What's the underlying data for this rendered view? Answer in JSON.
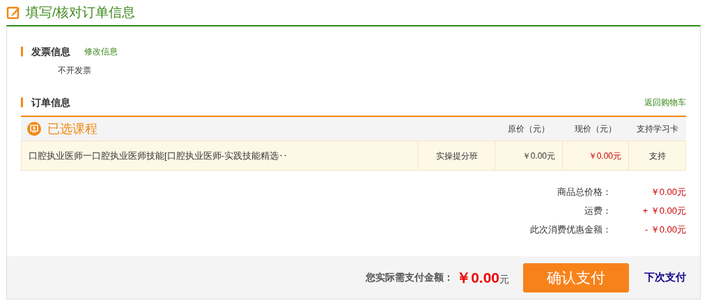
{
  "page_title": "填写/核对订单信息",
  "invoice": {
    "heading": "发票信息",
    "edit_link": "修改信息",
    "value": "不开发票"
  },
  "order": {
    "heading": "订单信息",
    "back_link": "返回购物车",
    "table": {
      "title": "已选课程",
      "columns": [
        "原价（元）",
        "现价（元）",
        "支持学习卡"
      ],
      "rows": [
        {
          "name": "口腔执业医师一口腔执业医师技能[口腔执业医师-实践技能精选‥",
          "type": "实操提分班",
          "original_price": "￥0.00元",
          "current_price": "￥0.00元",
          "card": "支持"
        }
      ]
    }
  },
  "summary": [
    {
      "label": "商品总价格：",
      "value": "￥0.00元"
    },
    {
      "label": "运费：",
      "value": "+ ￥0.00元"
    },
    {
      "label": "此次消费优惠金额：",
      "value": "- ￥0.00元"
    }
  ],
  "footer": {
    "label": "您实际需支付金额：",
    "amount": "￥0.00",
    "unit": "元",
    "pay_button": "确认支付",
    "later_link": "下次支付"
  }
}
